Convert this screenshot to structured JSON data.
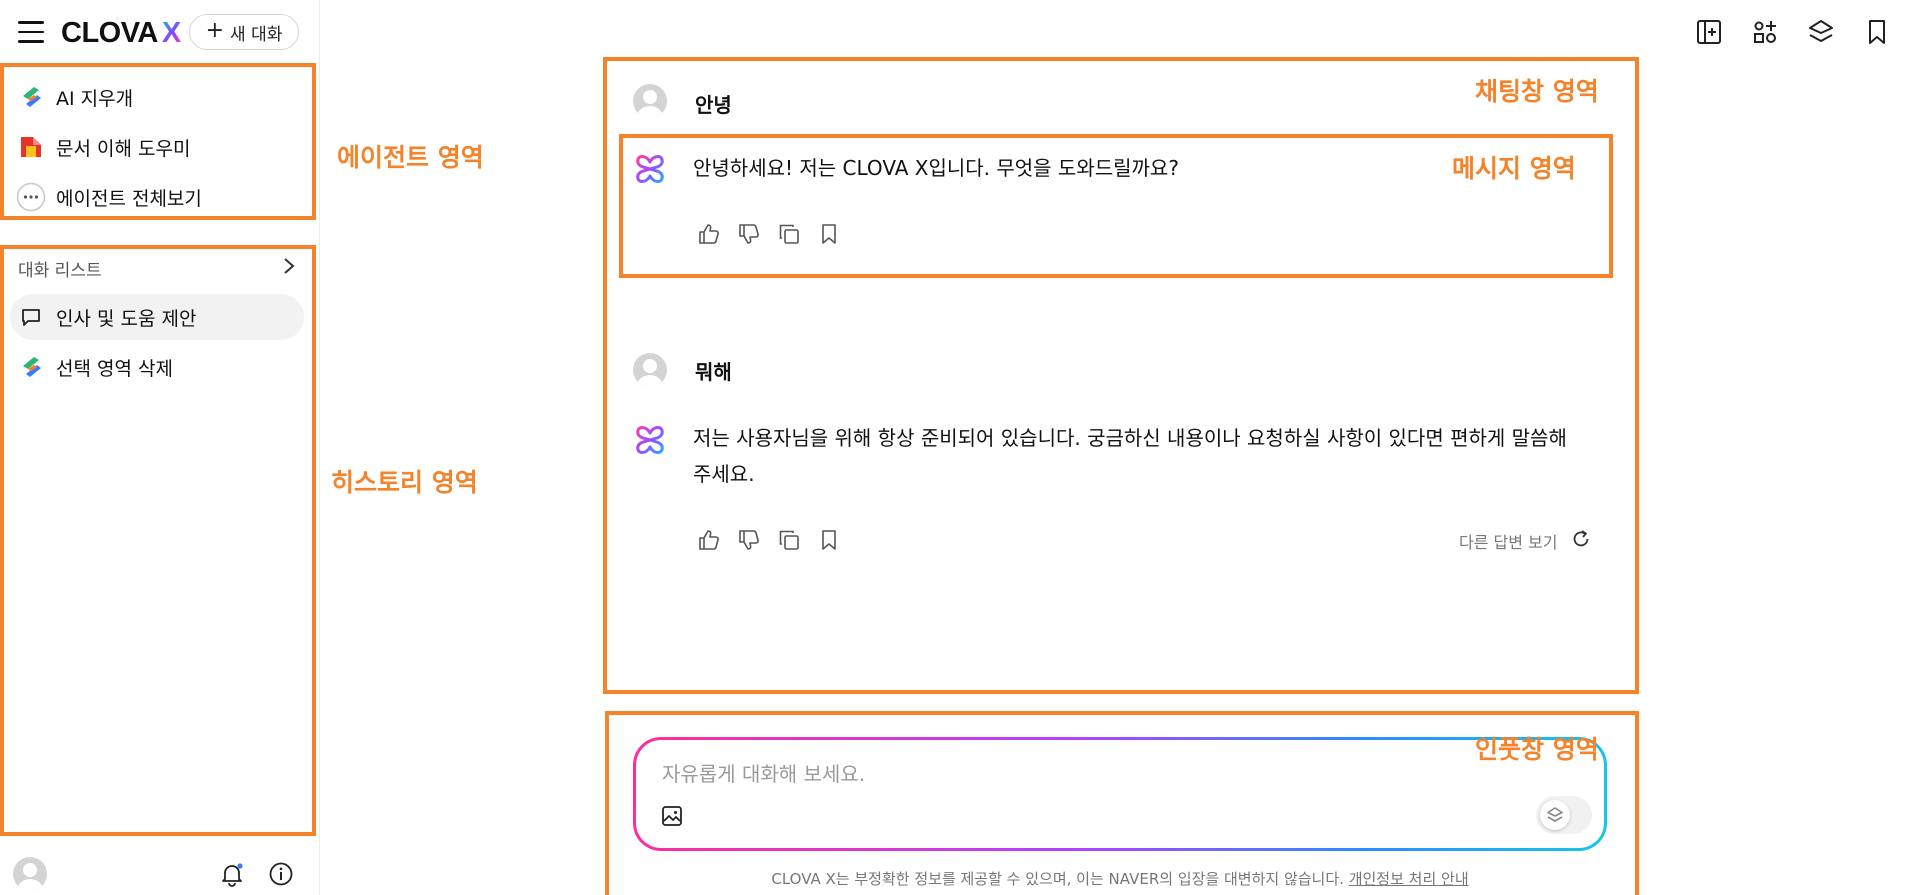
{
  "app": {
    "logo_text": "CLOVA",
    "logo_x": "X",
    "new_chat_label": "새 대화"
  },
  "agents": [
    {
      "label": "AI 지우개",
      "icon": "clova-brush-icon"
    },
    {
      "label": "문서 이해 도우미",
      "icon": "document-helper-icon"
    },
    {
      "label": "에이전트 전체보기",
      "icon": "more-dots-icon"
    }
  ],
  "history": {
    "header": "대화 리스트",
    "items": [
      {
        "label": "인사 및 도움 제안",
        "icon": "chat-bubble-icon",
        "active": true
      },
      {
        "label": "선택 영역 삭제",
        "icon": "clova-brush-icon",
        "active": false
      }
    ]
  },
  "chat": {
    "messages": [
      {
        "role": "user",
        "text": "안녕"
      },
      {
        "role": "assistant",
        "text": "안녕하세요! 저는 CLOVA X입니다. 무엇을 도와드릴까요?"
      },
      {
        "role": "user",
        "text": "뭐해"
      },
      {
        "role": "assistant",
        "text": "저는 사용자님을 위해 항상 준비되어 있습니다. 궁금하신 내용이나 요청하실 사항이 있다면 편하게 말씀해주세요."
      }
    ],
    "regenerate_label": "다른 답변 보기"
  },
  "input": {
    "placeholder": "자유롭게 대화해 보세요."
  },
  "disclaimer": {
    "text": "CLOVA X는 부정확한 정보를 제공할 수 있으며, 이는 NAVER의 입장을 대변하지 않습니다.",
    "link": "개인정보 처리 안내"
  },
  "annotations": {
    "agent_area": "에이전트 영역",
    "history_area": "히스토리 영역",
    "chat_area": "채팅창 영역",
    "message_area": "메시지 영역",
    "input_area": "인풋창 영역"
  },
  "colors": {
    "annotation": "#f5832a",
    "accent_pink": "#ff2d9a",
    "accent_purple": "#b540ff",
    "accent_blue": "#2a8cff"
  }
}
